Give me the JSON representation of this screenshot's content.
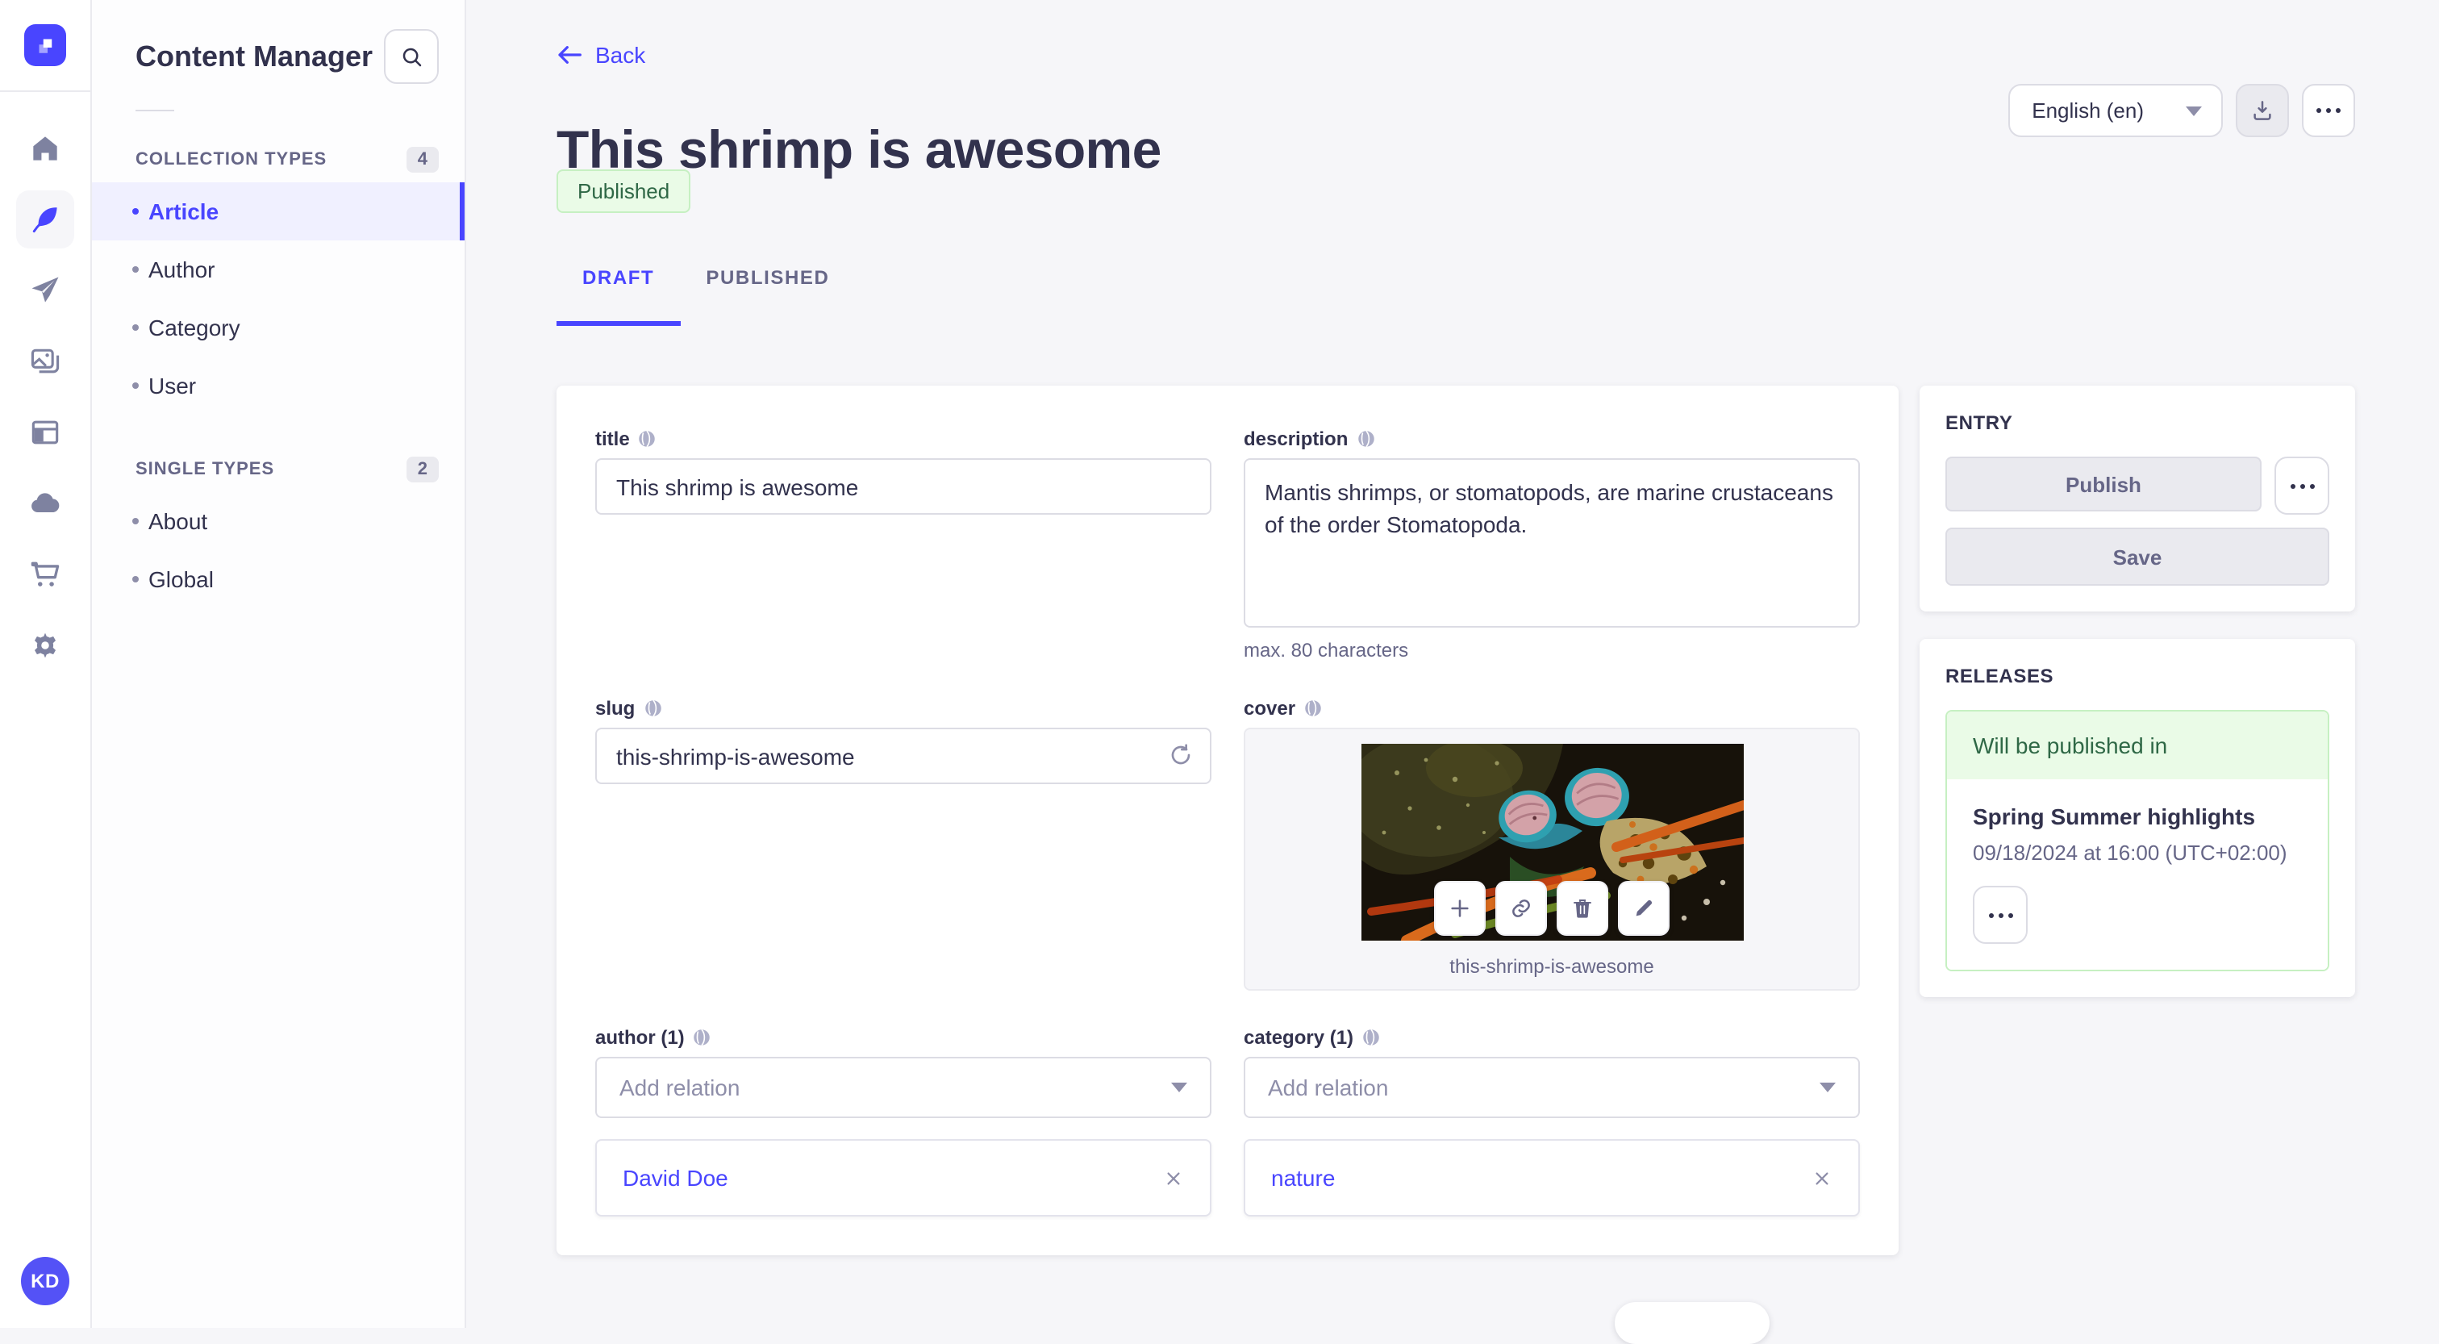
{
  "colors": {
    "primary": "#4945ff",
    "primary_light_bg": "#f0f0ff",
    "text": "#32324d",
    "muted": "#666687",
    "page_bg": "#f6f6f9",
    "border": "#dcdce4",
    "success_text": "#2f6846",
    "success_bg": "#eafbe7",
    "success_border": "#c6f0c2"
  },
  "rail": {
    "logo_icon": "strapi-logo",
    "items": [
      {
        "icon": "home-icon"
      },
      {
        "icon": "feather-content-icon",
        "active": true
      },
      {
        "icon": "paper-plane-icon"
      },
      {
        "icon": "media-library-icon"
      },
      {
        "icon": "layout-builder-icon"
      },
      {
        "icon": "cloud-icon"
      },
      {
        "icon": "cart-icon"
      },
      {
        "icon": "gear-icon"
      }
    ],
    "avatar_initials": "KD"
  },
  "sidebar": {
    "title": "Content Manager",
    "search_icon": "search-icon",
    "sections": [
      {
        "label": "COLLECTION TYPES",
        "count": "4",
        "items": [
          {
            "label": "Article",
            "active": true
          },
          {
            "label": "Author"
          },
          {
            "label": "Category"
          },
          {
            "label": "User"
          }
        ]
      },
      {
        "label": "SINGLE TYPES",
        "count": "2",
        "items": [
          {
            "label": "About"
          },
          {
            "label": "Global"
          }
        ]
      }
    ]
  },
  "header": {
    "back_label": "Back",
    "title": "This shrimp is awesome",
    "status_badge": "Published",
    "locale_value": "English (en)",
    "toolbar_icons": [
      "download-icon",
      "more-horizontal-icon"
    ],
    "tabs": [
      {
        "label": "DRAFT",
        "active": true
      },
      {
        "label": "PUBLISHED"
      }
    ]
  },
  "form": {
    "title_field": {
      "label": "title",
      "value": "This shrimp is awesome"
    },
    "description_field": {
      "label": "description",
      "value": "Mantis shrimps, or stomatopods, are marine crustaceans of the order Stomatopoda.",
      "helper": "max. 80 characters"
    },
    "slug_field": {
      "label": "slug",
      "value": "this-shrimp-is-awesome",
      "icon": "regenerate-icon"
    },
    "cover_field": {
      "label": "cover",
      "caption": "this-shrimp-is-awesome",
      "toolbar_icons": [
        "plus-icon",
        "link-icon",
        "trash-icon",
        "pencil-icon"
      ]
    },
    "author_field": {
      "label": "author (1)",
      "placeholder": "Add relation",
      "relation": "David Doe"
    },
    "category_field": {
      "label": "category (1)",
      "placeholder": "Add relation",
      "relation": "nature"
    }
  },
  "entry_panel": {
    "title": "ENTRY",
    "publish_label": "Publish",
    "save_label": "Save"
  },
  "releases_panel": {
    "title": "RELEASES",
    "status": "Will be published in",
    "release_name": "Spring Summer highlights",
    "release_date": "09/18/2024 at 16:00 (UTC+02:00)"
  }
}
